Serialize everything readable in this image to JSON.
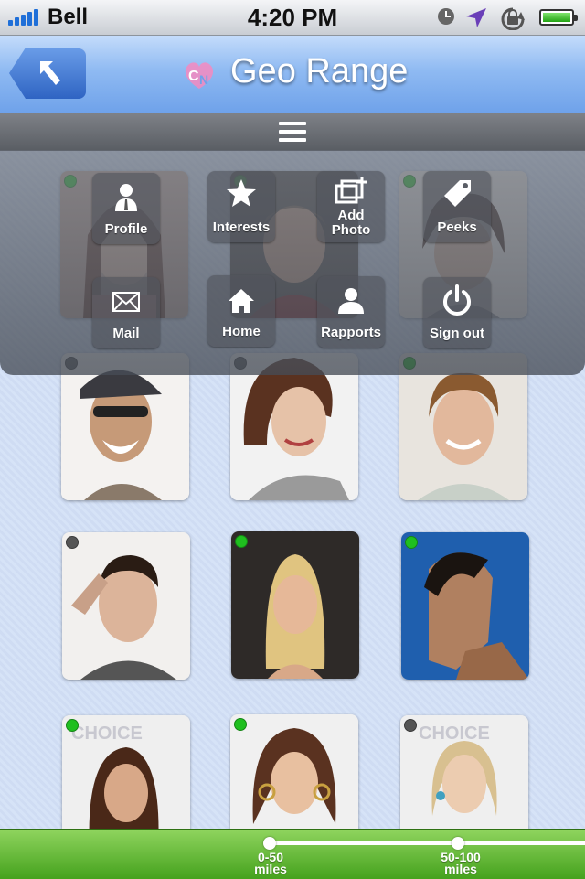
{
  "status_bar": {
    "carrier": "Bell",
    "time": "4:20 PM",
    "icons": [
      "signal-bars-icon",
      "clock-icon",
      "location-arrow-icon",
      "rotation-lock-icon",
      "battery-icon"
    ]
  },
  "nav": {
    "title": "Geo Range",
    "back_icon": "back-arrow-icon",
    "logo_icon": "app-logo-icon"
  },
  "menu_toggle_icon": "hamburger-icon",
  "menu": {
    "items": [
      {
        "label": "Profile",
        "icon": "profile-icon"
      },
      {
        "label": "Interests",
        "icon": "star-icon"
      },
      {
        "label": "Add Photo",
        "icon": "add-photo-icon"
      },
      {
        "label": "Peeks",
        "icon": "tag-icon"
      },
      {
        "label": "Mail",
        "icon": "envelope-icon"
      },
      {
        "label": "Home",
        "icon": "home-icon"
      },
      {
        "label": "Rapports",
        "icon": "people-icon"
      },
      {
        "label": "Sign out",
        "icon": "power-icon"
      }
    ]
  },
  "grid": {
    "status_colors": {
      "online": "#1fbf1f",
      "offline": "#555555"
    },
    "tiles": [
      {
        "status": "online"
      },
      {
        "status": "online"
      },
      {
        "status": "online"
      },
      {
        "status": "offline"
      },
      {
        "status": "offline"
      },
      {
        "status": "online"
      },
      {
        "status": "offline"
      },
      {
        "status": "online"
      },
      {
        "status": "online"
      },
      {
        "status": "online"
      },
      {
        "status": "online"
      },
      {
        "status": "offline"
      }
    ]
  },
  "range_slider": {
    "options": [
      {
        "line1": "0-50",
        "line2": "miles"
      },
      {
        "line1": "50-100",
        "line2": "miles"
      }
    ]
  },
  "colors": {
    "nav_blue": "#6fa2ea",
    "range_green": "#45a21d"
  }
}
